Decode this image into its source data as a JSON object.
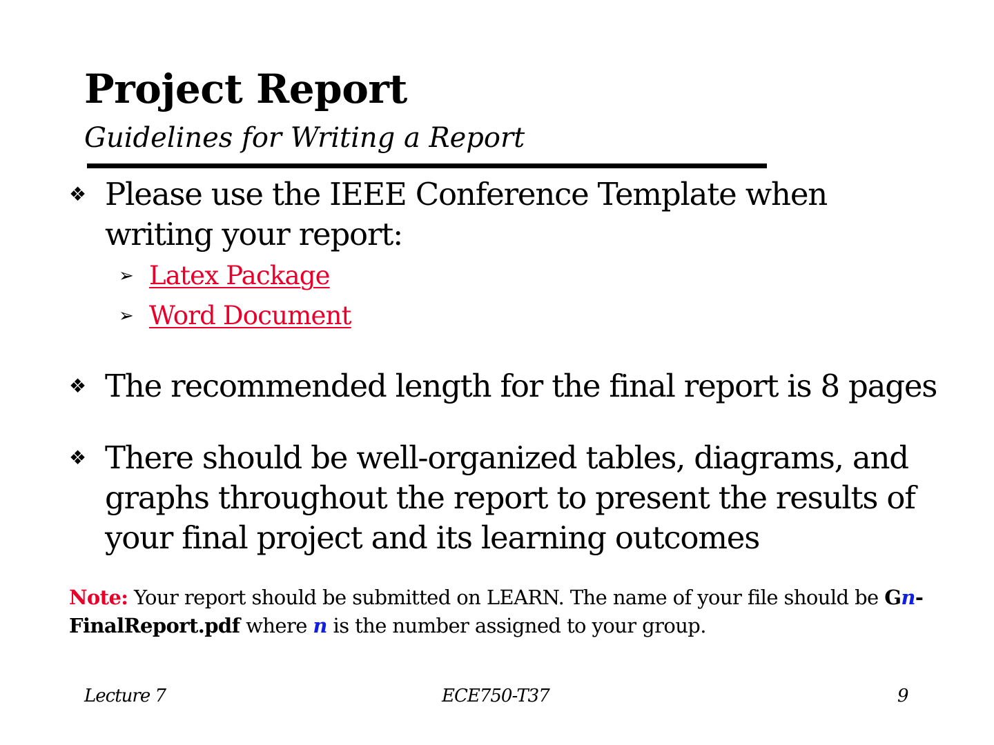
{
  "slide": {
    "title": "Project Report",
    "subtitle": "Guidelines for Writing a Report"
  },
  "bullets": [
    {
      "marker": "❖",
      "text": "Please use the IEEE Conference Template when writing your report:",
      "subitems": [
        {
          "marker": "➢",
          "text": "Latex Package"
        },
        {
          "marker": "➢",
          "text": "Word Document"
        }
      ]
    },
    {
      "marker": "❖",
      "text": "The recommended length for the final report is 8 pages"
    },
    {
      "marker": "❖",
      "text": "There should be well-organized tables, diagrams, and graphs throughout the report to present the results of your final project and its learning outcomes"
    }
  ],
  "note": {
    "label": "Note:",
    "text1": " Your report should be submitted on LEARN. The name of your file should be ",
    "file_prefix": "G",
    "n": "n",
    "file_suffix": "-FinalReport.pdf",
    "text2": " where ",
    "text3": " is the number assigned to your group."
  },
  "footer": {
    "left": "Lecture 7",
    "center": "ECE750-T37",
    "page": "9"
  },
  "colors": {
    "link": "#e8002a",
    "note_label": "#e8002a",
    "variable": "#1020e0"
  }
}
